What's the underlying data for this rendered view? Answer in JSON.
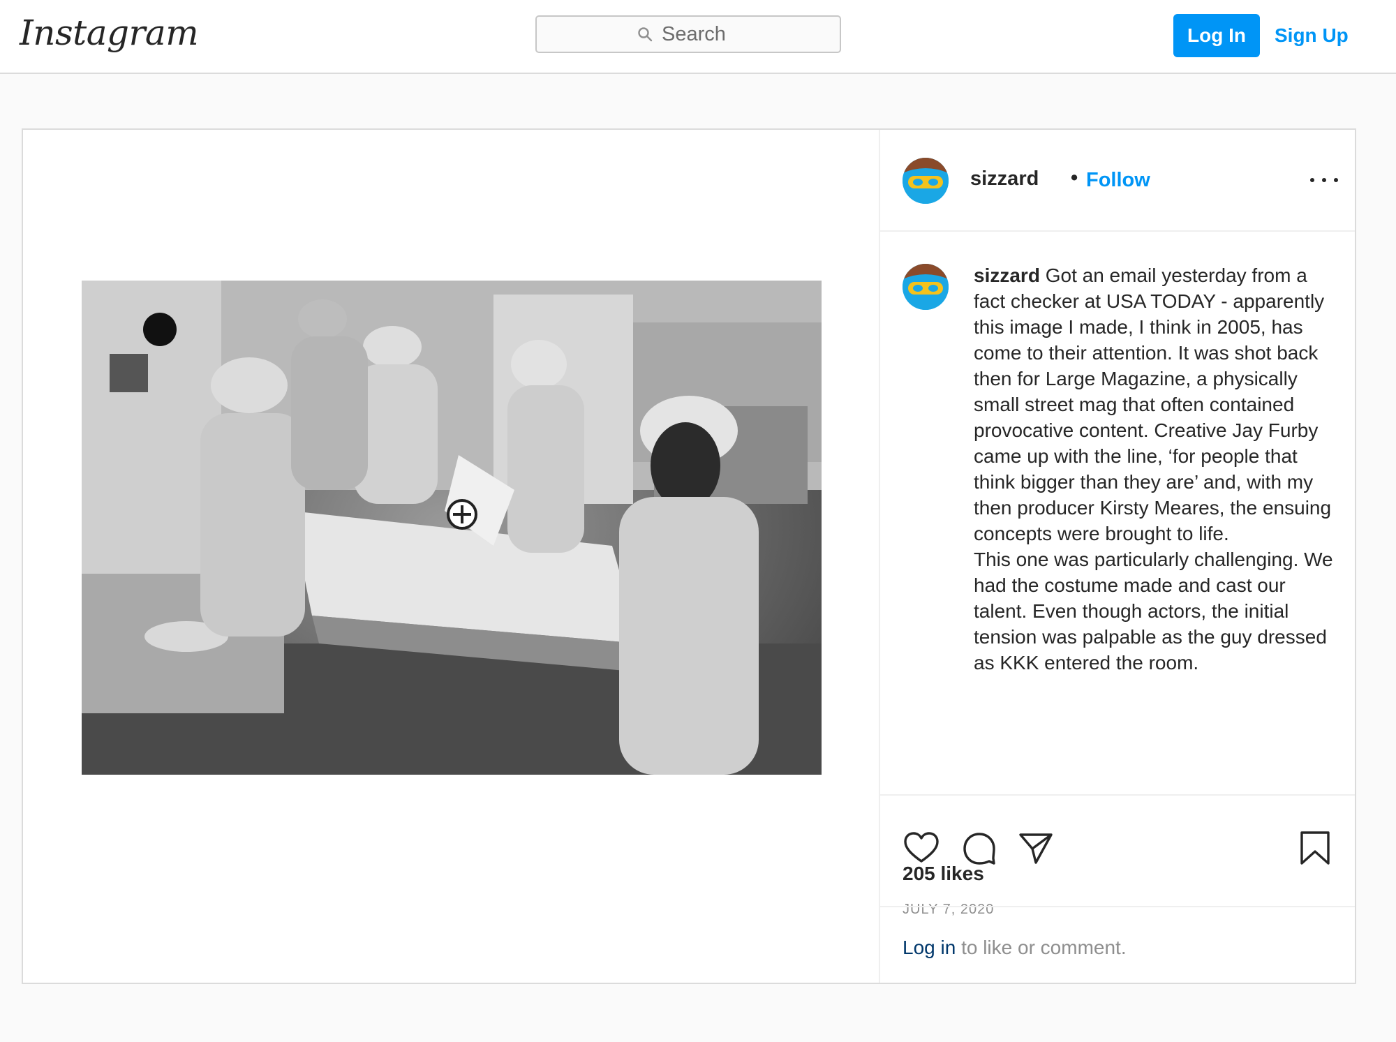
{
  "nav": {
    "logo": "Instagram",
    "search_placeholder": "Search",
    "login_label": "Log In",
    "signup_label": "Sign Up"
  },
  "post": {
    "username": "sizzard",
    "separator": "•",
    "follow_label": "Follow",
    "more_icon": "more-options-icon",
    "caption_user": "sizzard",
    "caption_text": "Got an email yesterday from a fact checker at USA TODAY - apparently this image I made, I think in 2005, has come to their attention. It was shot back then for Large Magazine, a physically small street mag that often contained provocative content. Creative Jay Furby came up with the line, ‘for people that think bigger than they are’ and, with my then producer Kirsty Meares, the ensuing concepts were brought to life.\nThis one was particularly challenging. We had the costume made and cast our talent. Even though actors, the initial tension was palpable as the guy dressed as KKK entered the room.",
    "likes": "205 likes",
    "date": "JULY 7, 2020",
    "login_prompt_link": "Log in",
    "login_prompt_rest": " to like or comment."
  },
  "icons": {
    "like": "heart-icon",
    "comment": "comment-icon",
    "share": "paper-plane-icon",
    "save": "bookmark-icon",
    "search": "search-icon"
  },
  "colors": {
    "accent": "#0095f6",
    "text": "#262626",
    "muted": "#8e8e8e",
    "border": "#dbdbdb",
    "avatar_bg": "#1aa7e5"
  }
}
